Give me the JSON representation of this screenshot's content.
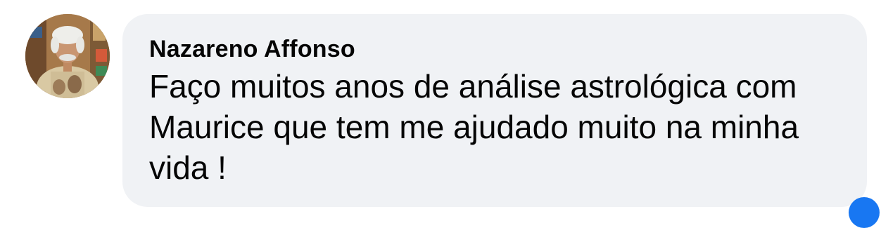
{
  "comment": {
    "author": "Nazareno Affonso",
    "text": "Faço muitos anos de análise astrológica com Maurice que tem me ajudado muito na minha vida !"
  },
  "icons": {
    "avatar": "user-avatar-photo",
    "corner": "reaction-badge-icon"
  },
  "colors": {
    "bubble_bg": "#f0f2f5",
    "text": "#050505",
    "badge": "#1877f2"
  }
}
